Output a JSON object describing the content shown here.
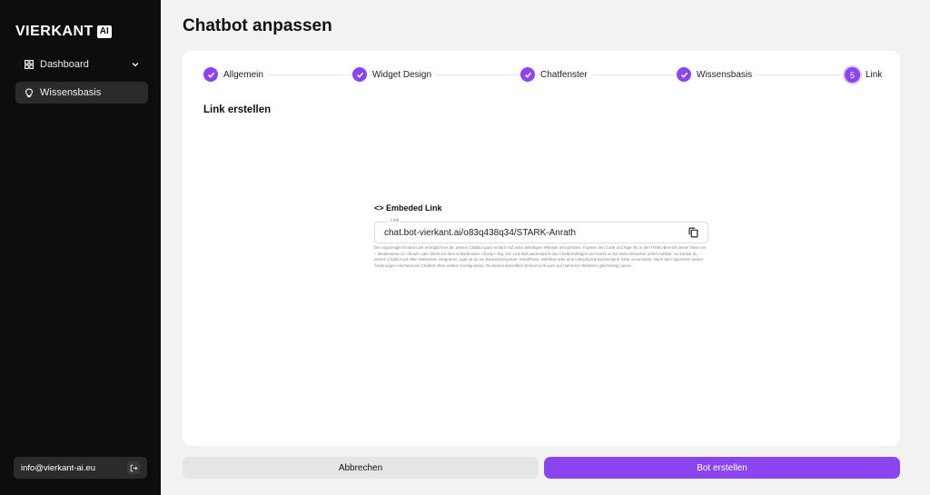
{
  "sidebar": {
    "logo_text": "VIERKANT",
    "logo_badge": "AI",
    "items": [
      {
        "label": "Dashboard",
        "icon": "dashboard-grid-icon",
        "expandable": true
      },
      {
        "label": "Wissensbasis",
        "icon": "lightbulb-icon",
        "active": true
      }
    ],
    "user_email": "info@vierkant-ai.eu"
  },
  "main": {
    "page_title": "Chatbot anpassen",
    "steps": [
      {
        "label": "Allgemein",
        "state": "done"
      },
      {
        "label": "Widget Design",
        "state": "done"
      },
      {
        "label": "Chatfenster",
        "state": "done"
      },
      {
        "label": "Wissensbasis",
        "state": "done"
      },
      {
        "label": "Link",
        "state": "current",
        "number": "5"
      }
    ],
    "section_title": "Link erstellen",
    "embed": {
      "title": "<> Embeded Link",
      "field_label": "Link",
      "value": "chat.bot-vierkant.ai/o83q438q34/STARK-Anrath",
      "description": "Der angezeigte Embed-Link ermöglicht es dir, deinen Chatbot ganz einfach auf jeder beliebigen Website einzubinden. Kopiere den Code und füge ihn in den HTML-Bereich deiner Seite ein – idealerweise im <head> oder direkt vor dem schließenden </body>-Tag. Der Link lädt automatisch das Chatbot-Widget und macht es für deine Besucher sofort nutzbar. So kannst du deinen Chatbot auf allen Webseiten integrieren, egal ob du ein Baukastensystem, WordPress, Webflow oder eine individuell programmierte Seite verwendest. Nach dem Speichern deiner Änderungen erscheint der Chatbot ohne weitere Konfiguration. Du kannst denselben Embed-Link auch auf mehreren Websites gleichzeitig nutzen."
    }
  },
  "footer": {
    "cancel_label": "Abbrechen",
    "create_label": "Bot erstellen"
  },
  "colors": {
    "accent": "#8b45f0",
    "sidebar_bg": "#0d0d0d"
  }
}
